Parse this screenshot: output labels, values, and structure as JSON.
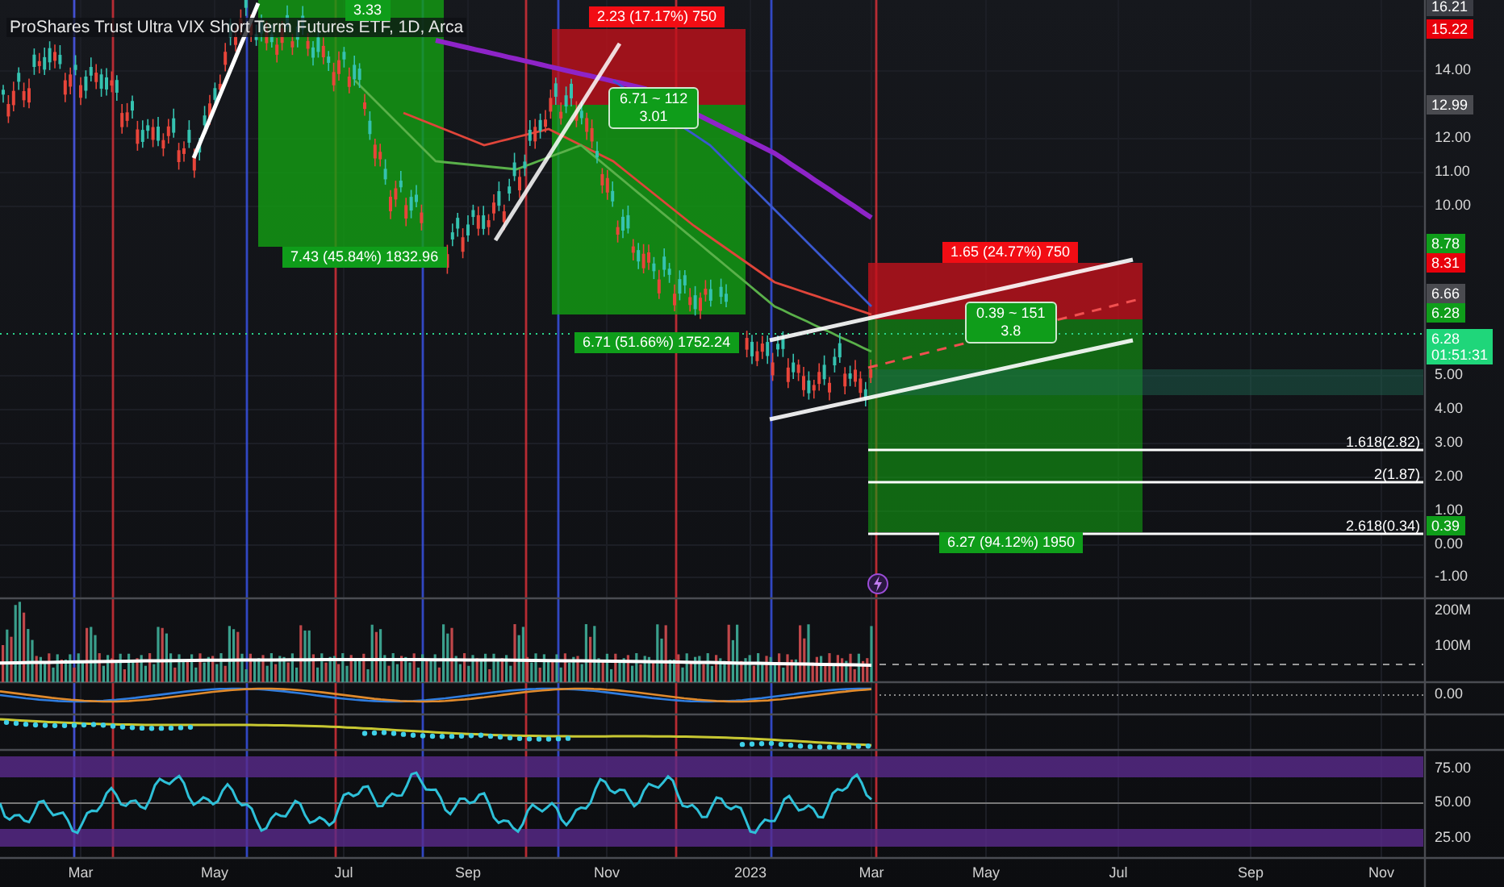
{
  "title": "ProShares Trust Ultra VIX Short Term Futures ETF, 1D, Arca",
  "trade_labels": [
    {
      "kind": "profit",
      "lines": [
        "3.33"
      ]
    },
    {
      "kind": "profit",
      "lines": [
        "7.43 (45.84%) 1832.96"
      ]
    },
    {
      "kind": "loss",
      "lines": [
        "2.23 (17.17%) 750"
      ]
    },
    {
      "kind": "stats",
      "lines": [
        "6.71 ~ 112",
        "3.01"
      ]
    },
    {
      "kind": "profit",
      "lines": [
        "6.71 (51.66%) 1752.24"
      ]
    },
    {
      "kind": "loss",
      "lines": [
        "1.65 (24.77%) 750"
      ]
    },
    {
      "kind": "stats",
      "lines": [
        "0.39 ~ 151",
        "3.8"
      ]
    },
    {
      "kind": "profit",
      "lines": [
        "6.27 (94.12%) 1950"
      ]
    }
  ],
  "fib_levels": [
    "1.618(2.82)",
    "2(1.87)",
    "2.618(0.34)"
  ],
  "price_axis": {
    "ticks": [
      "14.00",
      "12.00",
      "11.00",
      "10.00",
      "5.00",
      "4.00",
      "3.00",
      "2.00",
      "1.00",
      "0.00",
      "-1.00"
    ]
  },
  "price_tags": [
    {
      "text": "16.21",
      "color": "#3b3d44"
    },
    {
      "text": "15.22",
      "color": "#e8000b"
    },
    {
      "text": "12.99",
      "color": "#4a4b50"
    },
    {
      "text": "8.78",
      "color": "#0f9d1a"
    },
    {
      "text": "8.31",
      "color": "#e8000b"
    },
    {
      "text": "6.66",
      "color": "#4a4b50"
    },
    {
      "text": "6.28",
      "color": "#0f9d1a"
    },
    {
      "text": "6.28",
      "timer": "01:51:31",
      "color": "#1fd67a"
    },
    {
      "text": "0.39",
      "color": "#0f9d1a"
    }
  ],
  "volume_axis": [
    "200M",
    "100M"
  ],
  "macd_axis": [
    "0.00"
  ],
  "rsi_axis": [
    "75.00",
    "50.00",
    "25.00"
  ],
  "time_axis": [
    "Mar",
    "May",
    "Jul",
    "Sep",
    "Nov",
    "2023",
    "Mar",
    "May",
    "Jul",
    "Sep",
    "Nov"
  ]
}
